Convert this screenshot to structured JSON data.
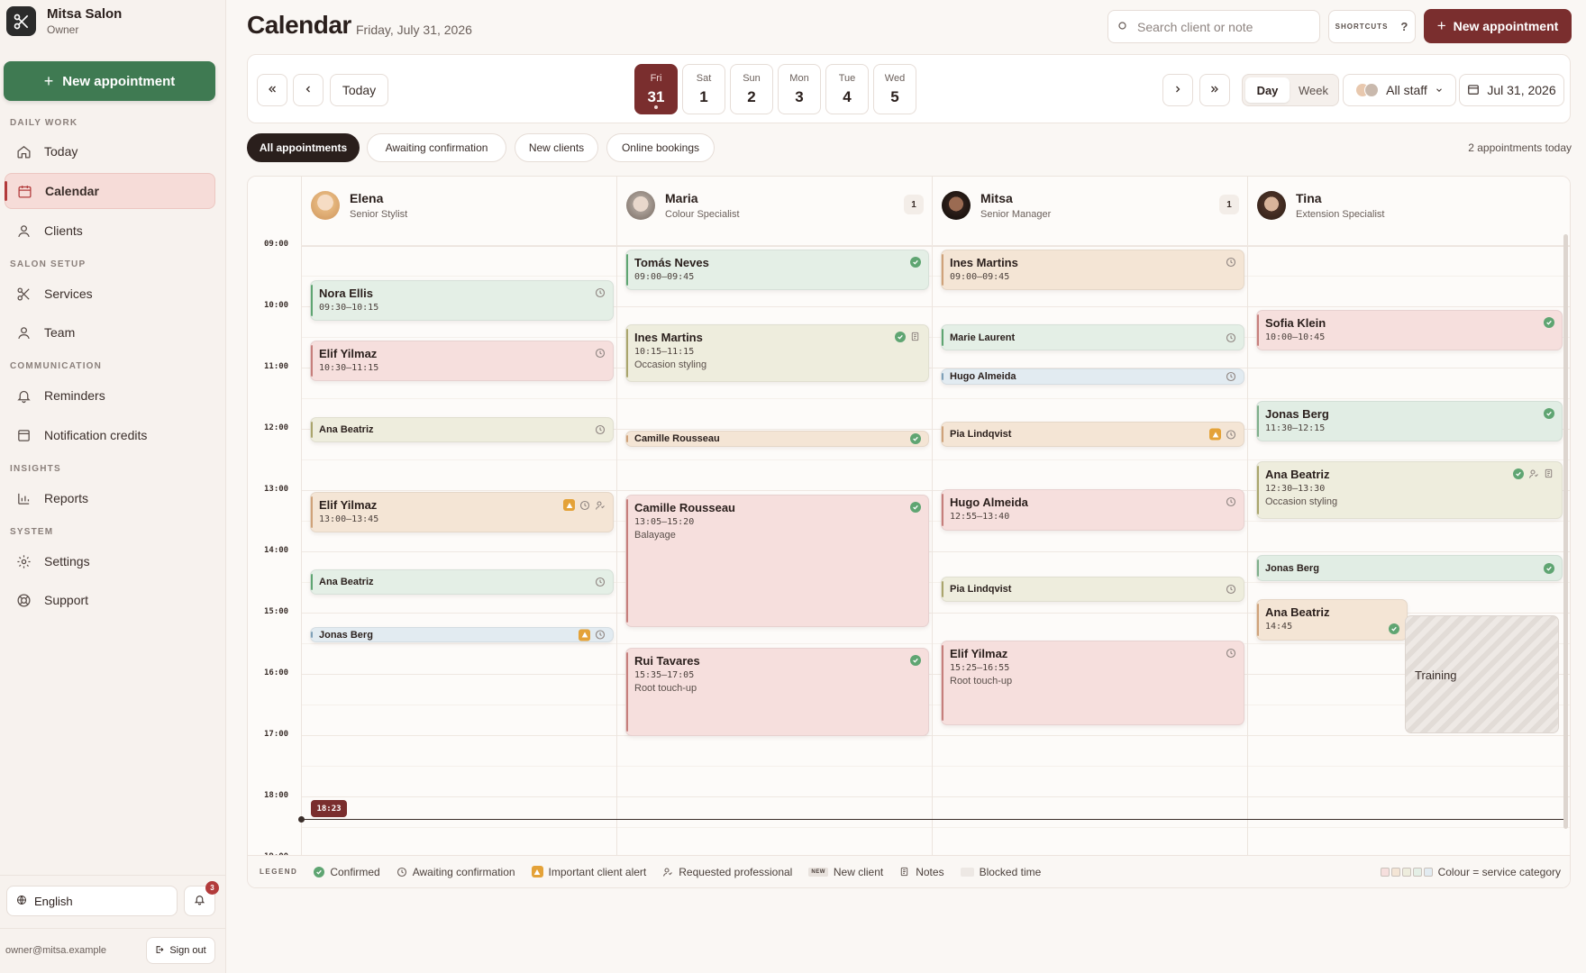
{
  "brand": {
    "name": "Mitsa Salon",
    "role": "Owner"
  },
  "sidebar": {
    "new_appointment": "New appointment",
    "sections": [
      {
        "label": "DAILY WORK"
      },
      {
        "label": "SALON SETUP"
      },
      {
        "label": "COMMUNICATION"
      },
      {
        "label": "INSIGHTS"
      },
      {
        "label": "SYSTEM"
      }
    ],
    "items": [
      {
        "label": "Today",
        "icon": "home-icon"
      },
      {
        "label": "Calendar",
        "icon": "calendar-icon",
        "active": true
      },
      {
        "label": "Clients",
        "icon": "user-icon"
      },
      {
        "label": "Services",
        "icon": "scissors-icon"
      },
      {
        "label": "Team",
        "icon": "user-icon"
      },
      {
        "label": "Reminders",
        "icon": "bell-icon"
      },
      {
        "label": "Notification credits",
        "icon": "credit-icon"
      },
      {
        "label": "Reports",
        "icon": "bar-chart-icon"
      },
      {
        "label": "Settings",
        "icon": "gear-icon"
      },
      {
        "label": "Support",
        "icon": "lifebuoy-icon"
      }
    ],
    "language": "English",
    "notification_count": "3",
    "email": "owner@mitsa.example",
    "sign_out": "Sign out"
  },
  "header": {
    "title": "Calendar",
    "date": "Friday, July 31, 2026",
    "search_placeholder": "Search client or note",
    "shortcuts": "SHORTCUTS",
    "shortcuts_key": "?",
    "new_appointment": "New appointment"
  },
  "toolbar": {
    "today": "Today",
    "days": [
      {
        "name": "Fri",
        "num": "31",
        "active": true
      },
      {
        "name": "Sat",
        "num": "1"
      },
      {
        "name": "Sun",
        "num": "2"
      },
      {
        "name": "Mon",
        "num": "3"
      },
      {
        "name": "Tue",
        "num": "4"
      },
      {
        "name": "Wed",
        "num": "5"
      }
    ],
    "view_day": "Day",
    "view_week": "Week",
    "staff_filter": "All staff",
    "date_picker": "Jul 31, 2026"
  },
  "filters": [
    "All appointments",
    "Awaiting confirmation",
    "New clients",
    "Online bookings"
  ],
  "appointment_count": "2 appointments today",
  "staff": [
    {
      "name": "Elena",
      "role": "Senior Stylist",
      "count": ""
    },
    {
      "name": "Maria",
      "role": "Colour Specialist",
      "count": "1"
    },
    {
      "name": "Mitsa",
      "role": "Senior Manager",
      "count": "1"
    },
    {
      "name": "Tina",
      "role": "Extension Specialist",
      "count": ""
    }
  ],
  "hours": [
    "09:00",
    "10:00",
    "11:00",
    "12:00",
    "13:00",
    "14:00",
    "15:00",
    "16:00",
    "17:00",
    "18:00",
    "19:00"
  ],
  "now_time": "18:23",
  "appointments": [
    {
      "col": 0,
      "client": "Nora Ellis",
      "time": "09:30–10:15",
      "service": "",
      "status": "awaiting",
      "color": "green"
    },
    {
      "col": 0,
      "client": "Elif Yilmaz",
      "time": "10:30–11:15",
      "service": "",
      "status": "awaiting",
      "color": "pink"
    },
    {
      "col": 0,
      "client": "Ana Beatriz",
      "time": "",
      "service": "",
      "status": "awaiting",
      "color": "olive"
    },
    {
      "col": 0,
      "client": "Elif Yilmaz",
      "time": "13:00–13:45",
      "service": "",
      "status": "awaiting",
      "alert": true,
      "requested": true,
      "color": "peach"
    },
    {
      "col": 0,
      "client": "Ana Beatriz",
      "time": "",
      "service": "",
      "status": "awaiting",
      "color": "green"
    },
    {
      "col": 0,
      "client": "Jonas Berg",
      "time": "",
      "service": "",
      "status": "awaiting",
      "alert": true,
      "color": "blue"
    },
    {
      "col": 1,
      "client": "Tomás Neves",
      "time": "09:00–09:45",
      "service": "",
      "status": "confirmed",
      "color": "green"
    },
    {
      "col": 1,
      "client": "Ines Martins",
      "time": "10:15–11:15",
      "service": "Occasion styling",
      "status": "confirmed",
      "notes": true,
      "color": "olive"
    },
    {
      "col": 1,
      "client": "Camille Rousseau",
      "time": "",
      "service": "",
      "status": "confirmed",
      "color": "peach"
    },
    {
      "col": 1,
      "client": "Camille Rousseau",
      "time": "13:05–15:20",
      "service": "Balayage",
      "status": "confirmed",
      "color": "pink"
    },
    {
      "col": 1,
      "client": "Rui Tavares",
      "time": "15:35–17:05",
      "service": "Root touch-up",
      "status": "confirmed",
      "color": "pink"
    },
    {
      "col": 2,
      "client": "Ines Martins",
      "time": "09:00–09:45",
      "service": "",
      "status": "awaiting",
      "color": "peach"
    },
    {
      "col": 2,
      "client": "Marie Laurent",
      "time": "",
      "service": "",
      "status": "awaiting",
      "color": "green"
    },
    {
      "col": 2,
      "client": "Hugo Almeida",
      "time": "",
      "service": "",
      "status": "awaiting",
      "color": "blue"
    },
    {
      "col": 2,
      "client": "Pia Lindqvist",
      "time": "",
      "service": "",
      "status": "awaiting",
      "alert": true,
      "color": "peach"
    },
    {
      "col": 2,
      "client": "Hugo Almeida",
      "time": "12:55–13:40",
      "service": "",
      "status": "awaiting",
      "color": "pink"
    },
    {
      "col": 2,
      "client": "Pia Lindqvist",
      "time": "",
      "service": "",
      "status": "awaiting",
      "color": "olive"
    },
    {
      "col": 2,
      "client": "Elif Yilmaz",
      "time": "15:25–16:55",
      "service": "Root touch-up",
      "status": "awaiting",
      "color": "pink"
    },
    {
      "col": 3,
      "client": "Sofia Klein",
      "time": "10:00–10:45",
      "service": "",
      "status": "confirmed",
      "color": "pink"
    },
    {
      "col": 3,
      "client": "Jonas Berg",
      "time": "11:30–12:15",
      "service": "",
      "status": "confirmed",
      "color": "mint"
    },
    {
      "col": 3,
      "client": "Ana Beatriz",
      "time": "12:30–13:30",
      "service": "Occasion styling",
      "status": "confirmed",
      "requested": true,
      "notes": true,
      "color": "olive"
    },
    {
      "col": 3,
      "client": "Jonas Berg",
      "time": "",
      "service": "",
      "status": "confirmed",
      "color": "mint"
    },
    {
      "col": 3,
      "client": "Ana Beatriz",
      "time": "14:45",
      "service": "",
      "status": "confirmed",
      "color": "peach"
    }
  ],
  "blocked": {
    "label": "Training"
  },
  "legend": {
    "title": "LEGEND",
    "confirmed": "Confirmed",
    "awaiting": "Awaiting confirmation",
    "alert": "Important client alert",
    "requested": "Requested professional",
    "new_badge": "NEW",
    "new_client": "New client",
    "notes": "Notes",
    "blocked": "Blocked time",
    "colour": "Colour = service category"
  },
  "colors": {
    "primary": "#7a2e2e",
    "sidebar_cta": "#3f7a52",
    "confirmed": "#5fa572",
    "alert": "#e4a238"
  }
}
